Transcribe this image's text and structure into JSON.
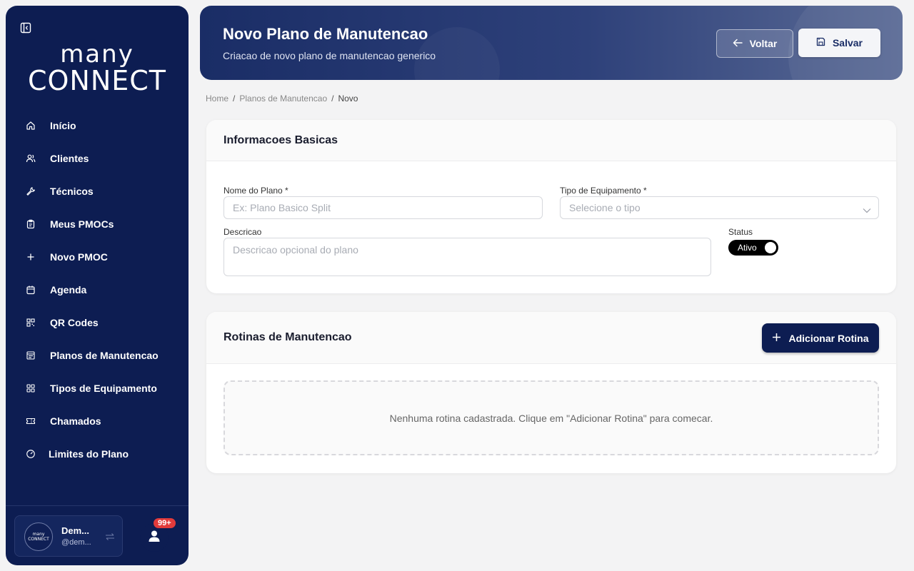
{
  "sidebar": {
    "logo_line1": "many",
    "logo_line2": "CONNECT",
    "items": [
      {
        "label": "Início",
        "icon": "home-icon"
      },
      {
        "label": "Clientes",
        "icon": "users-icon"
      },
      {
        "label": "Técnicos",
        "icon": "wrench-icon"
      },
      {
        "label": "Meus PMOCs",
        "icon": "clipboard-icon"
      },
      {
        "label": "Novo PMOC",
        "icon": "plus-icon"
      },
      {
        "label": "Agenda",
        "icon": "calendar-icon"
      },
      {
        "label": "QR Codes",
        "icon": "qrcode-icon"
      },
      {
        "label": "Planos de Manutencao",
        "icon": "list-icon"
      },
      {
        "label": "Tipos de Equipamento",
        "icon": "grid-icon"
      },
      {
        "label": "Chamados",
        "icon": "ticket-icon"
      },
      {
        "label": "Limites do Plano",
        "icon": "gauge-icon"
      }
    ],
    "account": {
      "avatar_text1": "many",
      "avatar_text2": "CONNECT",
      "name": "Dem...",
      "username": "@dem..."
    },
    "notifications_badge": "99+"
  },
  "header": {
    "title": "Novo Plano de Manutencao",
    "subtitle": "Criacao de novo plano de manutencao generico",
    "back_label": "Voltar",
    "save_label": "Salvar"
  },
  "breadcrumb": {
    "home": "Home",
    "section": "Planos de Manutencao",
    "current": "Novo",
    "separator": "/"
  },
  "basic_info": {
    "title": "Informacoes Basicas",
    "name_label": "Nome do Plano *",
    "name_placeholder": "Ex: Plano Basico Split",
    "type_label": "Tipo de Equipamento *",
    "type_placeholder": "Selecione o tipo",
    "description_label": "Descricao",
    "description_placeholder": "Descricao opcional do plano",
    "status_label": "Status",
    "status_value": "Ativo"
  },
  "routines": {
    "title": "Rotinas de Manutencao",
    "add_label": "Adicionar Rotina",
    "empty_message": "Nenhuma rotina cadastrada. Clique em \"Adicionar Rotina\" para comecar."
  },
  "colors": {
    "sidebar_bg": "#0d1d52",
    "accent": "#0d1d52",
    "badge": "#e23b3b",
    "logo_dot": "#f08a24"
  }
}
